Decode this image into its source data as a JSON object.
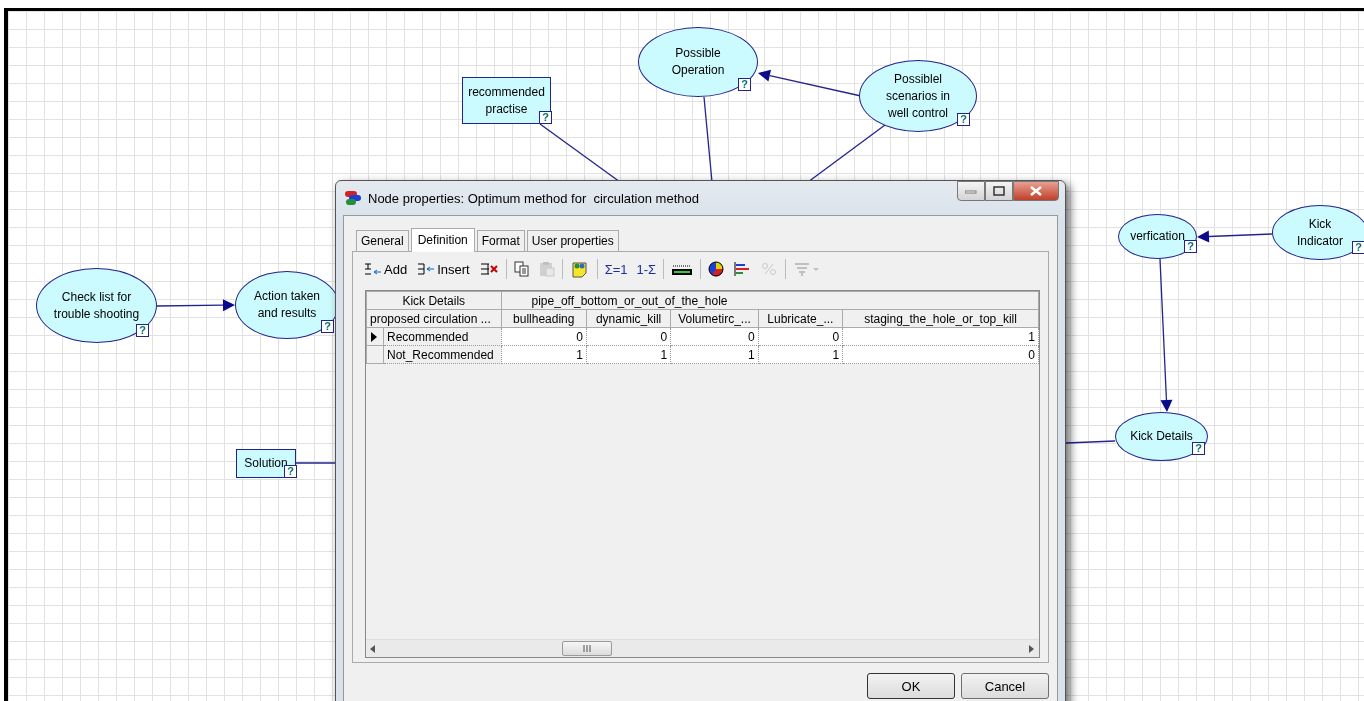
{
  "canvas": {
    "nodes": [
      {
        "label": "recommended practise",
        "kind": "box",
        "help_mark": "?"
      },
      {
        "label": "Possible Operation",
        "kind": "ellipse",
        "help_mark": "?"
      },
      {
        "label": "Possiblel scenarios in well control",
        "kind": "ellipse",
        "help_mark": "?"
      },
      {
        "label": "Check list for trouble shooting",
        "kind": "ellipse",
        "help_mark": "?"
      },
      {
        "label": "Action taken and results",
        "kind": "ellipse",
        "help_mark": "?"
      },
      {
        "label": "Solution",
        "kind": "box",
        "help_mark": "?"
      },
      {
        "label": "verfication",
        "kind": "ellipse",
        "help_mark": "?"
      },
      {
        "label": "Kick Indicator",
        "kind": "ellipse",
        "help_mark": "?"
      },
      {
        "label": "Kick Details",
        "kind": "ellipse",
        "help_mark": "?"
      }
    ]
  },
  "dialog": {
    "title": "Node properties: Optimum method for  circulation method",
    "tabs": [
      {
        "label": "General",
        "selected": false
      },
      {
        "label": "Definition",
        "selected": true
      },
      {
        "label": "Format",
        "selected": false
      },
      {
        "label": "User properties",
        "selected": false
      }
    ],
    "toolbar": [
      {
        "kind": "add",
        "label": "Add",
        "disabled": false
      },
      {
        "kind": "insert",
        "label": "Insert",
        "disabled": false
      },
      {
        "kind": "delete",
        "disabled": false
      },
      {
        "kind": "separator"
      },
      {
        "kind": "copy",
        "disabled": false
      },
      {
        "kind": "paste",
        "disabled": true
      },
      {
        "kind": "separator"
      },
      {
        "kind": "note",
        "disabled": false
      },
      {
        "kind": "separator"
      },
      {
        "kind": "normalize",
        "label": "Σ=1",
        "disabled": false
      },
      {
        "kind": "complement",
        "label": "1-Σ",
        "disabled": false
      },
      {
        "kind": "separator"
      },
      {
        "kind": "range",
        "disabled": false
      },
      {
        "kind": "separator"
      },
      {
        "kind": "pie",
        "disabled": false
      },
      {
        "kind": "bars",
        "disabled": false
      },
      {
        "kind": "percent",
        "disabled": true
      },
      {
        "kind": "separator"
      },
      {
        "kind": "filter",
        "disabled": true
      }
    ],
    "table": {
      "corner_top": "Kick Details",
      "group_header": "pipe_off_bottom_or_out_of_the_hole",
      "corner_bottom": "proposed circulation ...",
      "columns": [
        "bullheading",
        "dynamic_kill",
        "Volumetirc_...",
        "Lubricate_...",
        "staging_the_hole_or_top_kill"
      ],
      "rows": [
        {
          "label": "Recommended",
          "selected": true,
          "values": [
            "0",
            "0",
            "0",
            "0",
            "1"
          ]
        },
        {
          "label": "Not_Recommended",
          "selected": false,
          "values": [
            "1",
            "1",
            "1",
            "1",
            "0"
          ]
        }
      ]
    },
    "buttons": [
      "OK",
      "Cancel"
    ]
  }
}
